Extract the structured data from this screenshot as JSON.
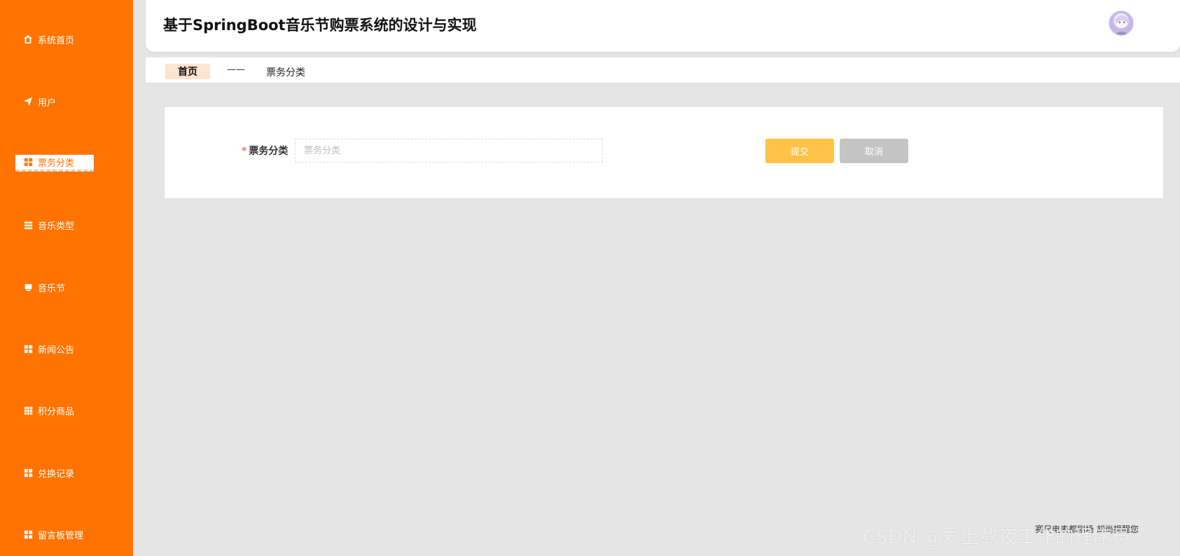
{
  "header": {
    "title": "基于SpringBoot音乐节购票系统的设计与实现"
  },
  "sidebar": {
    "items": [
      {
        "label": "系统首页",
        "icon": "home-icon"
      },
      {
        "label": "用户",
        "icon": "send-icon"
      },
      {
        "label": "票务分类",
        "icon": "grid-icon",
        "active": true
      },
      {
        "label": "音乐类型",
        "icon": "list-icon"
      },
      {
        "label": "音乐节",
        "icon": "monitor-icon"
      },
      {
        "label": "新闻公告",
        "icon": "grid-icon"
      },
      {
        "label": "积分商品",
        "icon": "table-icon"
      },
      {
        "label": "兑换记录",
        "icon": "grid-icon"
      },
      {
        "label": "留言板管理",
        "icon": "grid-icon"
      }
    ]
  },
  "breadcrumb": {
    "home": "首页",
    "separator": "——",
    "current": "票务分类"
  },
  "form": {
    "field_label": "票务分类",
    "required_mark": "*",
    "input_placeholder": "票务分类",
    "input_value": "",
    "submit_label": "提交",
    "cancel_label": "取消"
  },
  "overlay": {
    "watermark": "CSDN @爱上熬夜工作的程序员",
    "notice": "赛尺电表都剧场 胡尚提醒您"
  },
  "colors": {
    "sidebar": "#ff7300",
    "submit": "#ffc247",
    "cancel": "#c4c4c4",
    "breadcrumb_home_bg": "#fde3d0"
  }
}
